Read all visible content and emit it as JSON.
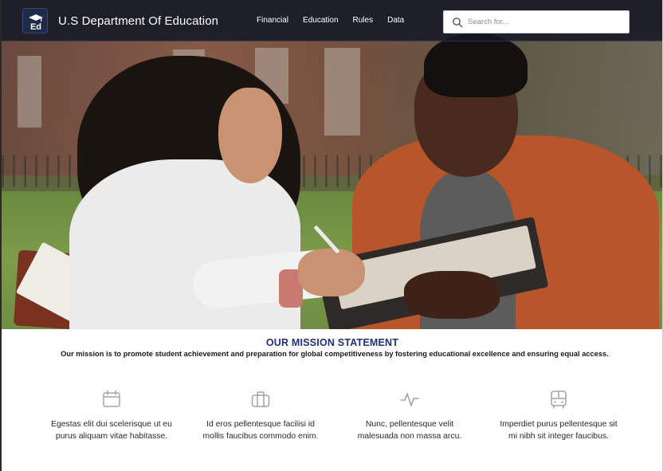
{
  "header": {
    "brand_name": "U.S Department Of Education",
    "logo_text": "Ed",
    "nav_items": [
      "Financial",
      "Education",
      "Rules",
      "Data"
    ],
    "search": {
      "placeholder": "Search for..."
    }
  },
  "hero": {
    "image_icon": "hero-photo"
  },
  "mission": {
    "title": "OUR MISSION STATEMENT",
    "text": "Our mission is to promote student achievement and preparation for global competitiveness by fostering educational excellence and ensuring equal access."
  },
  "features": [
    {
      "icon": "calendar-icon",
      "line1": "Egestas elit dui scelerisque ut eu",
      "line2": "purus aliquam vitae habitasse."
    },
    {
      "icon": "briefcase-icon",
      "line1": "Id eros pellentesque facilisi id",
      "line2": "mollis faucibus commodo enim."
    },
    {
      "icon": "activity-icon",
      "line1": "Nunc, pellentesque velit",
      "line2": "malesuada non massa arcu."
    },
    {
      "icon": "bus-icon",
      "line1": "Imperdiet purus pellentesque sit",
      "line2": "mi nibh sit integer faucibus."
    }
  ],
  "colors": {
    "nav_background": "#141826",
    "mission_title": "#1e3279",
    "icon_gray": "#9a9a9a"
  }
}
